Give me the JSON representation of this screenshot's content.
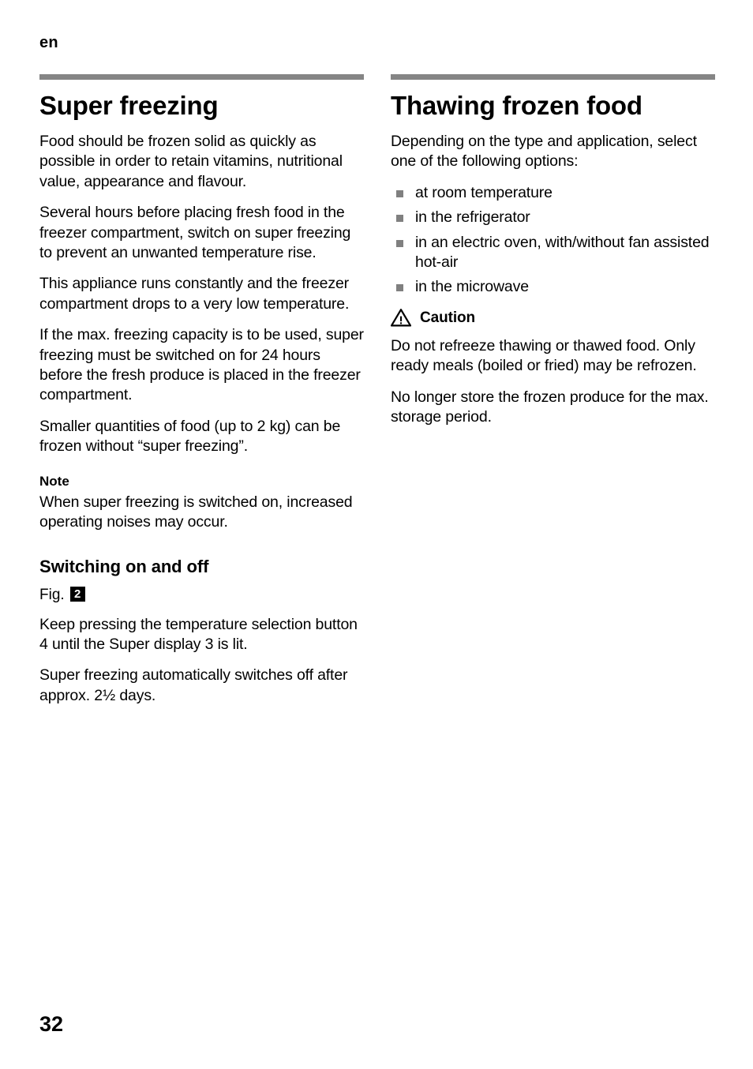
{
  "page": {
    "running_head": "en",
    "folio": "32",
    "rule_color": "#858585",
    "bullet_color": "#808080"
  },
  "left_column": {
    "title": "Super freezing",
    "paragraphs": [
      "Food should be frozen solid as quickly as possible in order to retain vitamins, nutritional value, appearance and flavour.",
      "Several hours before placing fresh food in the freezer compartment, switch on super freezing to prevent an unwanted temperature rise.",
      "This appliance runs constantly and the freezer compartment drops to a very low temperature.",
      "If the max. freezing capacity is to be used, super freezing must be switched on for 24 hours before the fresh produce is placed in the freezer compartment.",
      "Smaller quantities of food (up to 2 kg) can be frozen without “super freezing”."
    ],
    "note": {
      "heading": "Note",
      "text": "When super freezing is switched on, increased operating noises may occur."
    },
    "subsection": {
      "heading": "Switching on and off",
      "fig_label": "Fig.",
      "fig_number": "2",
      "paragraphs": [
        "Keep pressing the temperature selection button 4 until the Super display 3 is lit.",
        "Super freezing automatically switches off after approx. 2½ days."
      ]
    }
  },
  "right_column": {
    "title": "Thawing frozen food",
    "intro": "Depending on the type and application, select one of the following options:",
    "options": [
      "at room temperature",
      "in the refrigerator",
      "in an electric oven, with/without fan assisted hot-air",
      "in the microwave"
    ],
    "caution": {
      "label": "Caution",
      "icon": "warning-triangle-icon",
      "paragraphs": [
        "Do not refreeze thawing or thawed food. Only ready meals (boiled or fried) may be refrozen.",
        "No longer store the frozen produce for the max. storage period."
      ]
    }
  }
}
